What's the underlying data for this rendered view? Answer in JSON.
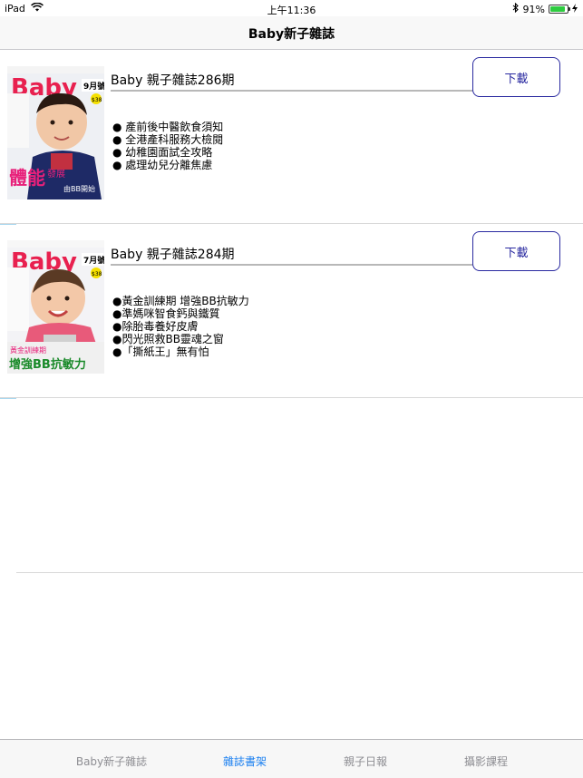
{
  "status_bar": {
    "device": "iPad",
    "time": "上午11:36",
    "battery_text": "91%",
    "battery_level": 0.91,
    "battery_color": "#2ecc40"
  },
  "nav": {
    "title": "Baby新子雜誌"
  },
  "magazines": [
    {
      "title": "Baby 親子雜誌286期",
      "download_label": "下載",
      "bullets": [
        "● 產前後中醫飲食須知",
        "● 全港產科服務大檢閱",
        "● 幼稚園面試全攻略",
        "● 處理幼兒分離焦慮"
      ],
      "cover": {
        "brand": "Baby",
        "issue": "9月號",
        "price": "$38",
        "headline_1": "體能",
        "headline_2": "發展",
        "headline_3": "由BB開始"
      }
    },
    {
      "title": "Baby 親子雜誌284期",
      "download_label": "下載",
      "bullets": [
        "●黃金訓練期 增強BB抗敏力",
        "●準媽咪智食鈣與鐵質",
        "●除胎毒養好皮膚",
        "●閃光照救BB靈魂之窗",
        "●「撕紙王」無有怕"
      ],
      "cover": {
        "brand": "Baby",
        "issue": "7月號",
        "price": "$38",
        "headline_1": "黃金訓練期",
        "headline_2": "增強BB抗敏力"
      }
    }
  ],
  "tabs": [
    {
      "label": "Baby新子雜誌",
      "active": false
    },
    {
      "label": "雜誌書架",
      "active": true
    },
    {
      "label": "親子日報",
      "active": false
    },
    {
      "label": "攝影課程",
      "active": false
    }
  ],
  "colors": {
    "accent": "#1a7ff0",
    "button_border": "#2a2aa0",
    "tab_inactive": "#8e8e93"
  }
}
